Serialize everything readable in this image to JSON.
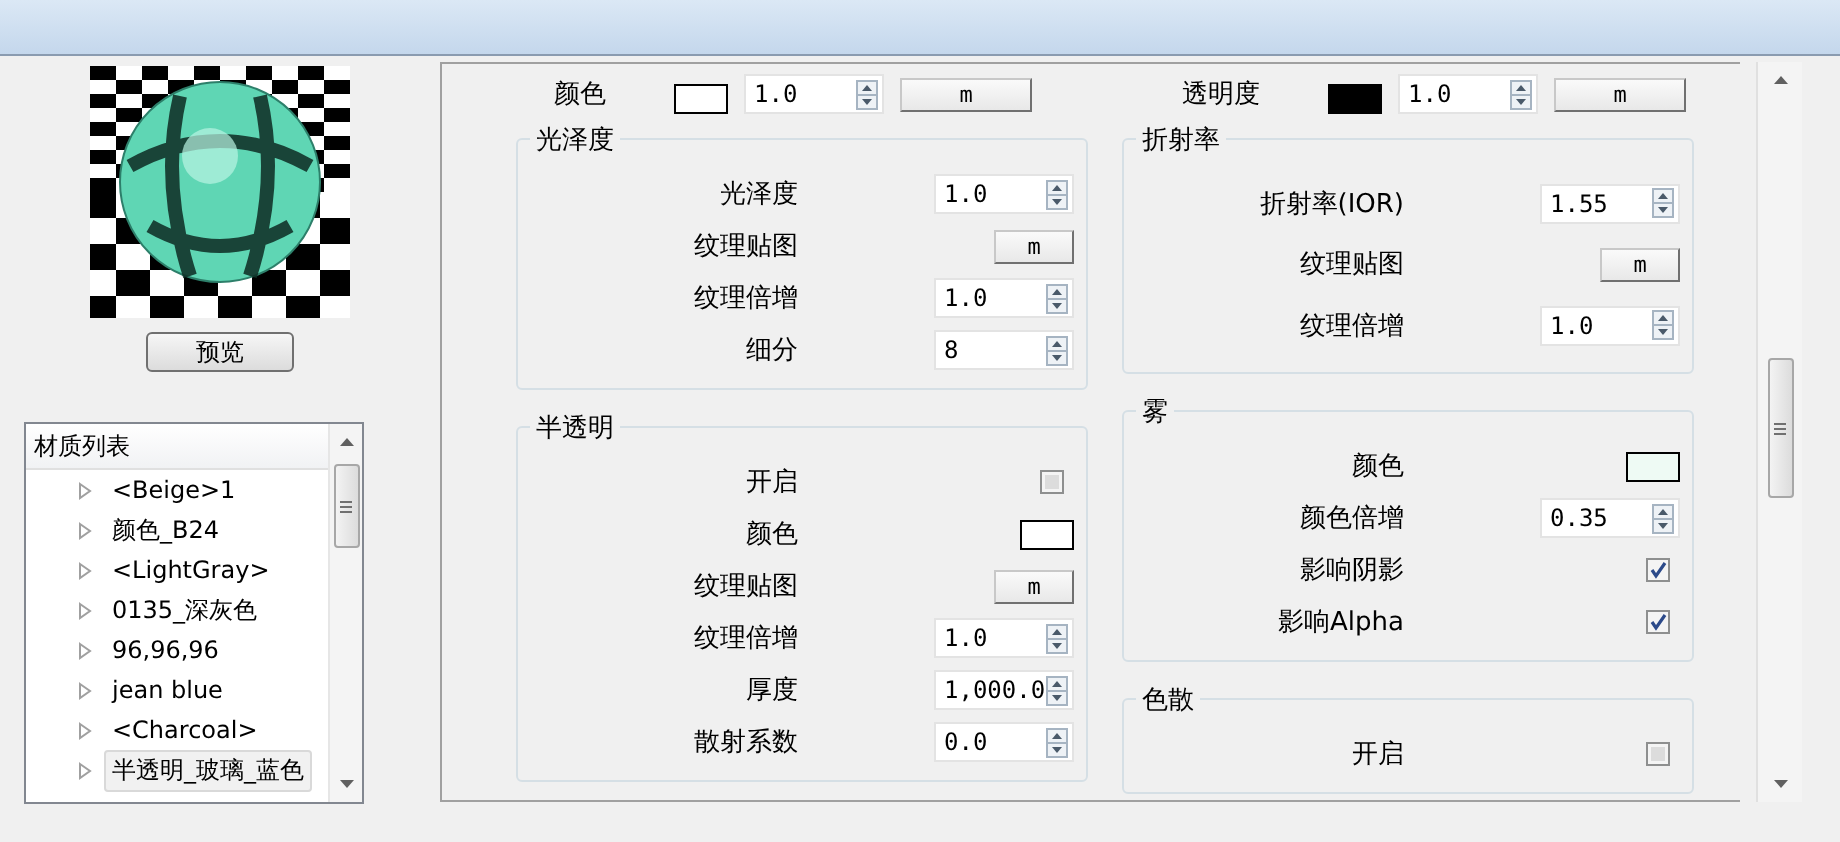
{
  "preview_button": "预览",
  "material_list": {
    "header": "材质列表",
    "items": [
      {
        "label": "<Beige>1",
        "selected": false
      },
      {
        "label": "颜色_B24",
        "selected": false
      },
      {
        "label": "<LightGray>",
        "selected": false
      },
      {
        "label": "0135_深灰色",
        "selected": false
      },
      {
        "label": "96,96,96",
        "selected": false
      },
      {
        "label": "jean blue",
        "selected": false
      },
      {
        "label": "<Charcoal>",
        "selected": false
      },
      {
        "label": "半透明_玻璃_蓝色",
        "selected": true
      }
    ]
  },
  "top_row": [
    {
      "label": "颜色",
      "color": "#ffffff",
      "value": "1.0",
      "map_button": "m"
    },
    {
      "label": "透明度",
      "color": "#000000",
      "value": "1.0",
      "map_button": "m"
    }
  ],
  "columns": [
    [
      {
        "title": "光泽度",
        "rows": [
          {
            "kind": "spinner",
            "label": "光泽度",
            "value": "1.0"
          },
          {
            "kind": "map",
            "label": "纹理贴图",
            "button": "m"
          },
          {
            "kind": "spinner",
            "label": "纹理倍增",
            "value": "1.0"
          },
          {
            "kind": "spinner",
            "label": "细分",
            "value": "8"
          }
        ]
      },
      {
        "title": "半透明",
        "rows": [
          {
            "kind": "checkbox",
            "label": "开启",
            "checked": false
          },
          {
            "kind": "color",
            "label": "颜色",
            "color": "#ffffff"
          },
          {
            "kind": "map",
            "label": "纹理贴图",
            "button": "m"
          },
          {
            "kind": "spinner",
            "label": "纹理倍增",
            "value": "1.0"
          },
          {
            "kind": "spinner",
            "label": "厚度",
            "value": "1,000.0"
          },
          {
            "kind": "spinner",
            "label": "散射系数",
            "value": "0.0"
          }
        ]
      }
    ],
    [
      {
        "title": "折射率",
        "rows": [
          {
            "kind": "spinner",
            "label": "折射率(IOR)",
            "value": "1.55"
          },
          {
            "kind": "map",
            "label": "纹理贴图",
            "button": "m"
          },
          {
            "kind": "spinner",
            "label": "纹理倍增",
            "value": "1.0"
          }
        ]
      },
      {
        "title": "雾",
        "rows": [
          {
            "kind": "color",
            "label": "颜色",
            "color": "#eefaf4"
          },
          {
            "kind": "spinner",
            "label": "颜色倍增",
            "value": "0.35"
          },
          {
            "kind": "checkbox",
            "label": "影响阴影",
            "checked": true
          },
          {
            "kind": "checkbox",
            "label": "影响Alpha",
            "checked": true
          }
        ]
      },
      {
        "title": "色散",
        "rows": [
          {
            "kind": "checkbox",
            "label": "开启",
            "checked": false
          }
        ]
      }
    ]
  ]
}
